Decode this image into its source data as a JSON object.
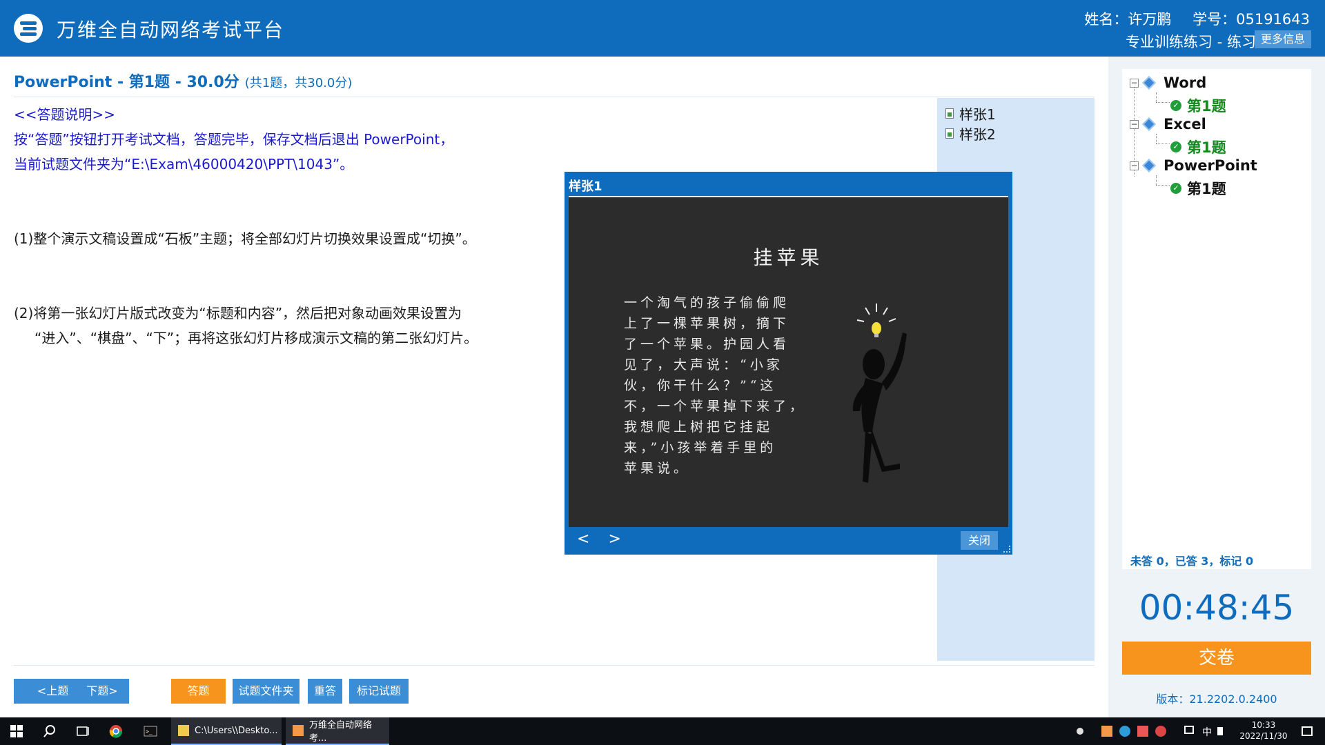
{
  "header": {
    "app_title": "万维全自动网络考试平台",
    "name": "姓名：许万鹏",
    "student_id": "学号：05191643",
    "mode": "专业训练练习 - 练习",
    "more_info": "更多信息"
  },
  "question": {
    "title": "PowerPoint - 第1题 - 30.0分",
    "subtitle": "(共1题，共30.0分)",
    "intro": [
      "<<答题说明>>",
      "按“答题”按钮打开考试文档，答题完毕，保存文档后退出 PowerPoint，",
      "当前试题文件夹为“E:\\Exam\\46000420\\PPT\\1043”。"
    ],
    "tasks": [
      "(1)整个演示文稿设置成“石板”主题；将全部幻灯片切换效果设置成“切换”。",
      "(2)将第一张幻灯片版式改变为“标题和内容”，然后把对象动画效果设置为",
      "“进入”、“棋盘”、“下”；再将这张幻灯片移成演示文稿的第二张幻灯片。"
    ]
  },
  "samples": [
    "样张1",
    "样张2"
  ],
  "preview": {
    "title": "样张1",
    "slide_title": "挂苹果",
    "slide_body": [
      "一个淘气的孩子偷偷爬",
      "上了一棵苹果树，摘下",
      "了一个苹果。护园人看",
      "见了，大声说：“小家",
      "伙，你干什么？”“这",
      "不，一个苹果掉下来了，",
      "我想爬上树把它挂起",
      "来，”小孩举着手里的",
      "苹果说。"
    ],
    "prev": "<",
    "next": ">",
    "close": "关闭"
  },
  "buttons": {
    "prev_q": "<上题",
    "next_q": "下题>",
    "answer": "答题",
    "folder": "试题文件夹",
    "redo": "重答",
    "mark": "标记试题"
  },
  "sidebar": {
    "tree": [
      {
        "label": "Word",
        "child": "第1题"
      },
      {
        "label": "Excel",
        "child": "第1题"
      },
      {
        "label": "PowerPoint",
        "child": "第1题"
      }
    ],
    "stats": "未答 0，已答 3，标记 0",
    "timer": "00:48:45",
    "submit": "交卷",
    "version": "版本：21.2202.0.2400"
  },
  "taskbar": {
    "app1": "C:\\Users\\\\Deskto...",
    "app2": "万维全自动网络考...",
    "ime": "中",
    "time": "10:33",
    "date": "2022/11/30"
  },
  "colors": {
    "brand": "#0f6cbd",
    "accent_orange": "#f7941d",
    "sample_panel": "#d4e6f7",
    "done_green": "#1f9e3a"
  }
}
